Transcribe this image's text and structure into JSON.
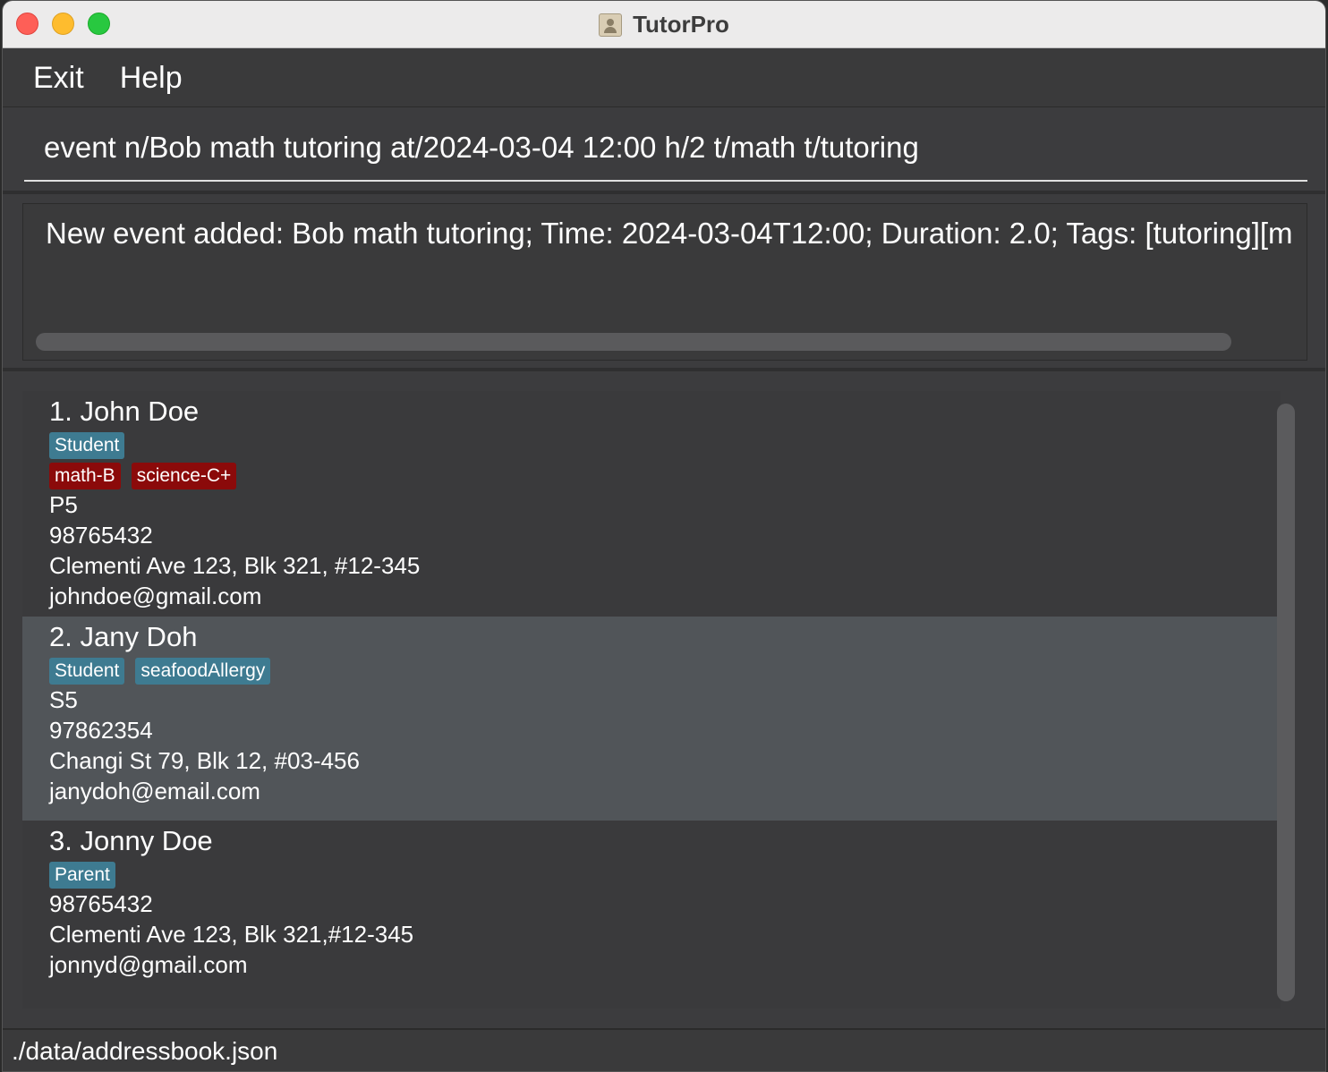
{
  "window": {
    "title": "TutorPro",
    "app_icon": "address-book-icon"
  },
  "menu": {
    "items": [
      "Exit",
      "Help"
    ]
  },
  "command": {
    "value": "event n/Bob math tutoring at/2024-03-04 12:00 h/2 t/math t/tutoring"
  },
  "result": {
    "text": "New event added: Bob math tutoring; Time: 2024-03-04T12:00; Duration: 2.0; Tags: [tutoring][m"
  },
  "persons": [
    {
      "name": "1.  John Doe",
      "tags_row1": [
        "Student"
      ],
      "tags_row2": [
        "math-B",
        "science-C+"
      ],
      "fields": [
        "P5",
        "98765432",
        "Clementi Ave 123, Blk 321, #12-345",
        "johndoe@gmail.com"
      ]
    },
    {
      "name": "2.  Jany Doh",
      "tags_row1": [
        "Student",
        "seafoodAllergy"
      ],
      "fields": [
        "S5",
        "97862354",
        "Changi St 79, Blk 12, #03-456",
        "janydoh@email.com"
      ]
    },
    {
      "name": "3.  Jonny Doe",
      "tags_row1": [
        "Parent"
      ],
      "fields": [
        "98765432",
        "Clementi Ave 123, Blk 321,#12-345",
        "jonnyd@gmail.com"
      ]
    }
  ],
  "status": {
    "path": "./data/addressbook.json"
  },
  "colors": {
    "role_tag": "#3e7b91",
    "grade_tag": "#8b0a0a",
    "selected_card": "#515559"
  }
}
